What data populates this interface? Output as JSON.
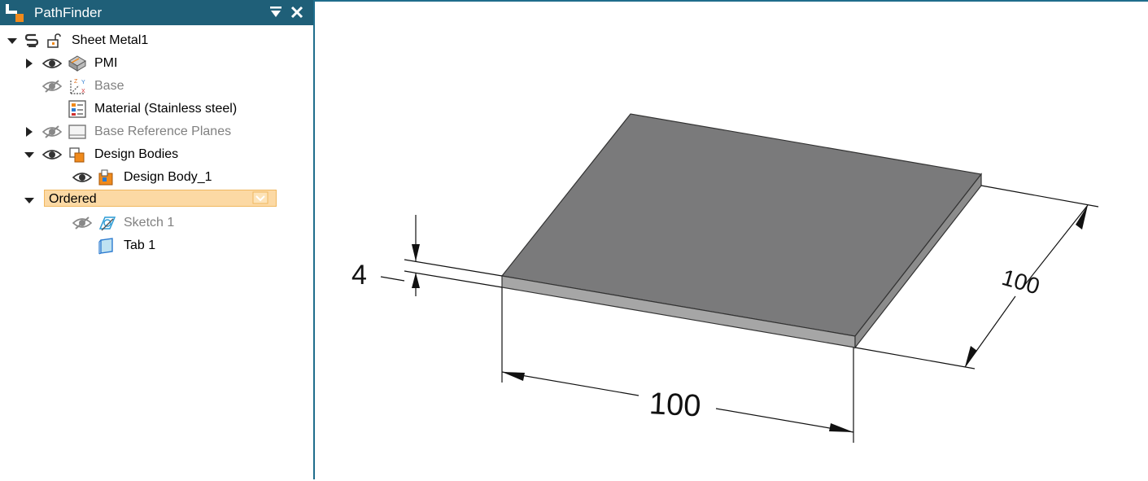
{
  "panel": {
    "title": "PathFinder",
    "collapse_icon": "dropdown-arrow-icon",
    "close_icon": "close-icon"
  },
  "tree": {
    "root": "Sheet Metal1",
    "pmi": "PMI",
    "base": "Base",
    "material": "Material (Stainless steel)",
    "base_planes": "Base Reference Planes",
    "design_bodies": "Design Bodies",
    "design_body_1": "Design Body_1",
    "ordered": "Ordered",
    "sketch_1": "Sketch 1",
    "tab_1": "Tab 1"
  },
  "dimensions": {
    "thickness": "4",
    "width": "100",
    "depth": "100"
  },
  "colors": {
    "title_bar": "#1f5f78",
    "ordered_highlight": "#fcd9a4",
    "plate_top": "#7a7a7b",
    "plate_edge": "#a6a6a6"
  }
}
